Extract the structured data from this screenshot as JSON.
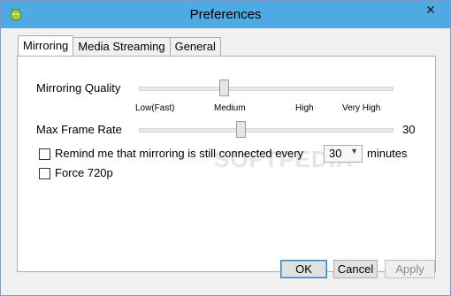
{
  "window": {
    "title": "Preferences",
    "close_symbol": "✕",
    "app_icon": "android-icon"
  },
  "tabs": [
    {
      "label": "Mirroring",
      "active": true
    },
    {
      "label": "Media Streaming",
      "active": false
    },
    {
      "label": "General",
      "active": false
    }
  ],
  "mirroring": {
    "quality_label": "Mirroring Quality",
    "quality_ticks": [
      "Low(Fast)",
      "Medium",
      "High",
      "Very High"
    ],
    "quality_selected": "Medium",
    "frame_rate_label": "Max Frame Rate",
    "frame_rate_value": "30",
    "remind_label": "Remind me that mirroring is still connected every",
    "remind_checked": false,
    "remind_interval": "30",
    "remind_unit": "minutes",
    "force720_label": "Force 720p",
    "force720_checked": false
  },
  "watermark": "SOFTPEDIA",
  "buttons": {
    "ok": "OK",
    "cancel": "Cancel",
    "apply": "Apply"
  }
}
